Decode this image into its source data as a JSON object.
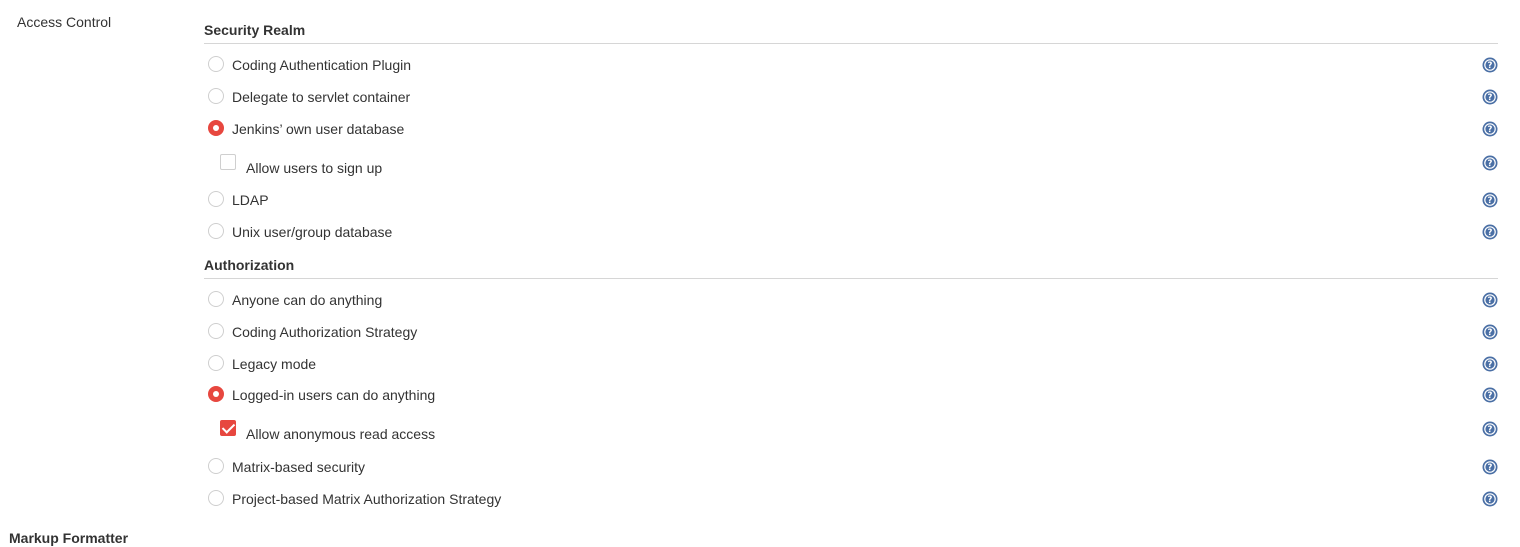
{
  "section": {
    "label": "Access Control"
  },
  "security_realm": {
    "title": "Security Realm",
    "options": [
      {
        "label": "Coding Authentication Plugin",
        "selected": false
      },
      {
        "label": "Delegate to servlet container",
        "selected": false
      },
      {
        "label": "Jenkins’ own user database",
        "selected": true
      },
      {
        "label": "Allow users to sign up",
        "checked": false
      },
      {
        "label": "LDAP",
        "selected": false
      },
      {
        "label": "Unix user/group database",
        "selected": false
      }
    ]
  },
  "authorization": {
    "title": "Authorization",
    "options": [
      {
        "label": "Anyone can do anything",
        "selected": false
      },
      {
        "label": "Coding Authorization Strategy",
        "selected": false
      },
      {
        "label": "Legacy mode",
        "selected": false
      },
      {
        "label": "Logged-in users can do anything",
        "selected": true
      },
      {
        "label": "Allow anonymous read access",
        "checked": true
      },
      {
        "label": "Matrix-based security",
        "selected": false
      },
      {
        "label": "Project-based Matrix Authorization Strategy",
        "selected": false
      }
    ]
  },
  "footer": {
    "label": "Markup Formatter"
  },
  "colors": {
    "accent": "#e7473f",
    "help": "#4a6fa5",
    "rule": "#d6d6d6"
  },
  "icons": {
    "help": "help-icon"
  }
}
